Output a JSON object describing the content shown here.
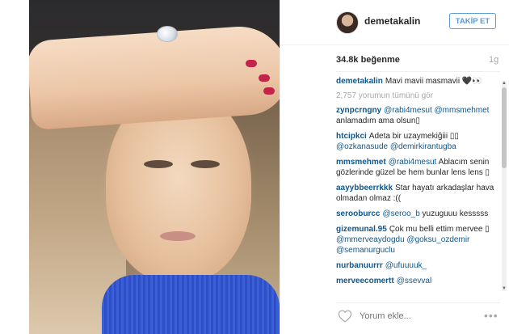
{
  "post": {
    "username": "demetakalin",
    "follow_label": "TAKİP ET",
    "likes": "34.8k beğenme",
    "time": "1g",
    "caption_user": "demetakalin",
    "caption_text": "Mavi mavii masmavii",
    "caption_emoji": "🖤👀",
    "view_all": "2,757 yorumun tümünü gör",
    "comment_placeholder": "Yorum ekle...",
    "more_label": "•••"
  },
  "comments": [
    {
      "user": "zynpcrngny",
      "mention": "@rabi4mesut @mmsmehmet",
      "text": "anlamadım ama olsun▯"
    },
    {
      "user": "htcipkci",
      "mention": "",
      "text": "Adeta bir uzaymekiğiii ▯▯",
      "mention2": "@ozkanasude @demirkirantugba"
    },
    {
      "user": "mmsmehmet",
      "mention": "@rabi4mesut",
      "text": "Ablacım senin gözlerinde güzel be hem bunlar lens lens ▯"
    },
    {
      "user": "aayybbeerrkkk",
      "mention": "",
      "text": "Star hayatı arkadaşlar hava olmadan olmaz :(("
    },
    {
      "user": "serooburcc",
      "mention": "@seroo_b",
      "text": "yuzuguuu kesssss"
    },
    {
      "user": "gizemunal.95",
      "mention": "",
      "text": "Çok mu belli ettim mervee ▯",
      "mention2": "@mmerveaydogdu @goksu_ozdemir @semanurguclu"
    },
    {
      "user": "nurbanuurrr",
      "mention": "@ufuuuuk_",
      "text": ""
    },
    {
      "user": "merveecomertt",
      "mention": "@ssevval",
      "text": ""
    }
  ],
  "colors": {
    "link": "#125688",
    "follow": "#5a9ad6",
    "muted": "#a8a8a8"
  }
}
